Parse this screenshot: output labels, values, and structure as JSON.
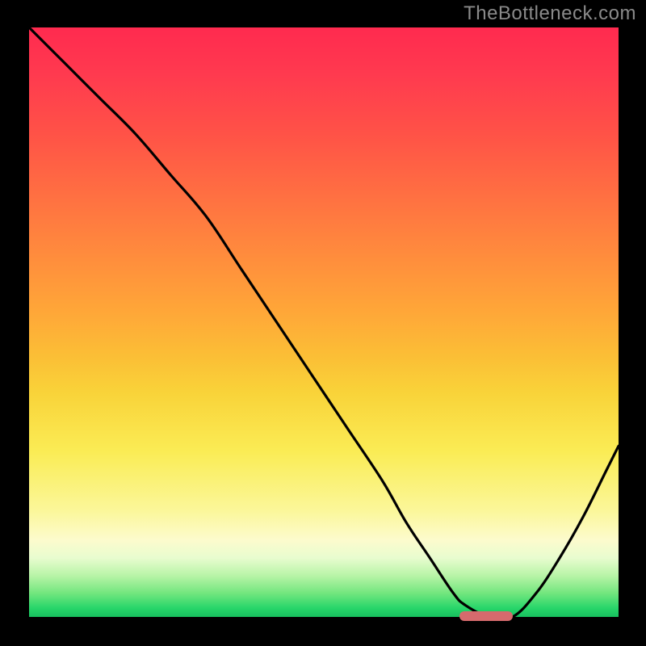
{
  "watermark": "TheBottleneck.com",
  "chart_data": {
    "type": "line",
    "title": "",
    "xlabel": "",
    "ylabel": "",
    "xlim": [
      0,
      100
    ],
    "ylim": [
      0,
      100
    ],
    "grid": false,
    "legend": false,
    "series": [
      {
        "name": "bottleneck-curve",
        "x": [
          0,
          6,
          12,
          18,
          24,
          30,
          36,
          42,
          48,
          54,
          60,
          64,
          68,
          72,
          74,
          78,
          82,
          86,
          90,
          94,
          98,
          100
        ],
        "y": [
          100,
          94,
          88,
          82,
          75,
          68,
          59,
          50,
          41,
          32,
          23,
          16,
          10,
          4,
          2,
          0,
          0,
          4,
          10,
          17,
          25,
          29
        ]
      }
    ],
    "annotations": [
      {
        "name": "optimal-marker",
        "x_start": 73,
        "x_end": 82,
        "y": 0,
        "color": "#d66a6d"
      }
    ],
    "background_gradient": {
      "top": "#ff2a4f",
      "mid": "#fbe24a",
      "bottom": "#17c05e"
    }
  }
}
